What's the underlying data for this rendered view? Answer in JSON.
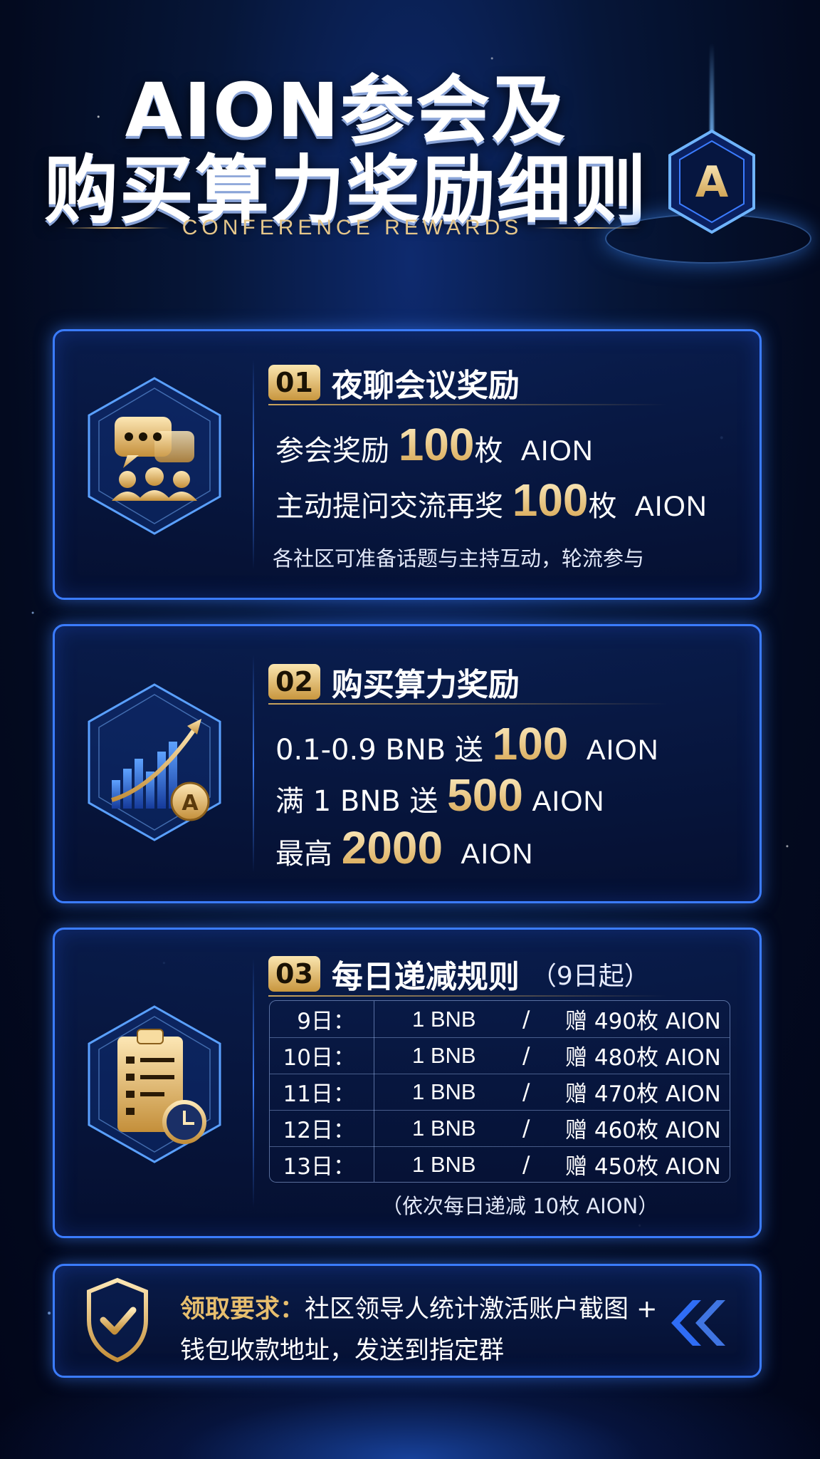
{
  "header": {
    "title_line1": "AION参会及",
    "title_line2": "购买算力奖励细则",
    "subtitle": "CONFERENCE REWARDS",
    "emblem_letter": "A"
  },
  "sections": [
    {
      "number": "01",
      "title": "夜聊会议奖励",
      "icon": "chat-people-icon",
      "line1": {
        "prefix": "参会奖励 ",
        "amount": "100",
        "unit": "枚",
        "token": "AION"
      },
      "line2": {
        "prefix": "主动提问交流再奖 ",
        "amount": "100",
        "unit": "枚",
        "token": "AION"
      },
      "note": "各社区可准备话题与主持互动，轮流参与"
    },
    {
      "number": "02",
      "title": "购买算力奖励",
      "icon": "growth-chart-coin-icon",
      "coin_letter": "A",
      "line1": {
        "prefix": "0.1-0.9 BNB 送 ",
        "amount": "100",
        "token": "AION"
      },
      "line2": {
        "prefix": "满 1 BNB 送 ",
        "amount": "500",
        "token": "AION"
      },
      "line3": {
        "prefix": "最高 ",
        "amount": "2000",
        "token": "AION"
      }
    },
    {
      "number": "03",
      "title": "每日递减规则",
      "title_note": "（9日起）",
      "icon": "clipboard-clock-icon",
      "rows": [
        {
          "day": "9日：",
          "bnb": "1 BNB",
          "slash": "/",
          "gift": "赠 490枚 AION"
        },
        {
          "day": "10日：",
          "bnb": "1 BNB",
          "slash": "/",
          "gift": "赠 480枚 AION"
        },
        {
          "day": "11日：",
          "bnb": "1 BNB",
          "slash": "/",
          "gift": "赠 470枚 AION"
        },
        {
          "day": "12日：",
          "bnb": "1 BNB",
          "slash": "/",
          "gift": "赠 460枚 AION"
        },
        {
          "day": "13日：",
          "bnb": "1 BNB",
          "slash": "/",
          "gift": "赠 450枚 AION"
        }
      ],
      "footnote": "（依次每日递减 10枚 AION）"
    }
  ],
  "claim": {
    "label": "领取要求：",
    "text1": "社区领导人统计激活账户截图 +",
    "text2": "钱包收款地址，发送到指定群",
    "icon": "shield-check-icon",
    "arrow_icon": "double-chevron-left-icon"
  },
  "colors": {
    "accent_blue": "#3b7cff",
    "gold": "#e7be6e",
    "background": "#030a1f"
  }
}
